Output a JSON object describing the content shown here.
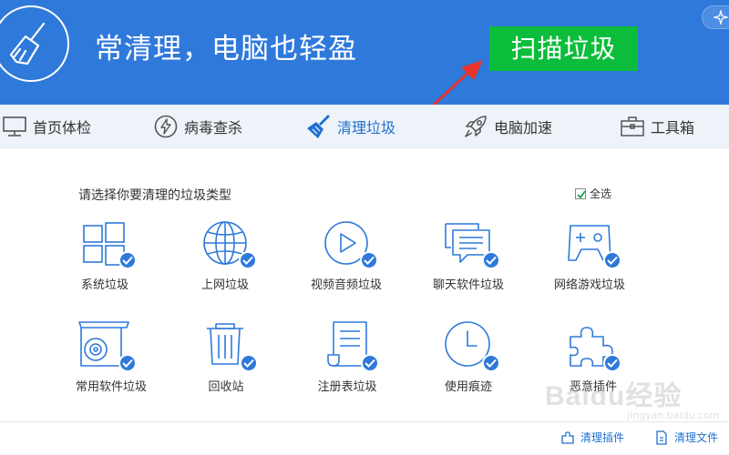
{
  "header": {
    "slogan": "常清理，电脑也轻盈",
    "scan_button": "扫描垃圾",
    "colors": {
      "header_bg": "#2f79db",
      "scan_bg": "#0bbd3a",
      "arrow": "#e8342a"
    }
  },
  "nav": {
    "items": [
      {
        "label": "首页体检",
        "icon": "monitor-icon"
      },
      {
        "label": "病毒查杀",
        "icon": "lightning-icon"
      },
      {
        "label": "清理垃圾",
        "icon": "broom-icon",
        "active": true
      },
      {
        "label": "电脑加速",
        "icon": "rocket-icon"
      },
      {
        "label": "工具箱",
        "icon": "toolbox-icon"
      }
    ]
  },
  "main": {
    "title": "请选择你要清理的垃圾类型",
    "select_all": "全选",
    "items": [
      {
        "label": "系统垃圾",
        "icon": "windows-icon",
        "checked": true
      },
      {
        "label": "上网垃圾",
        "icon": "globe-icon",
        "checked": true
      },
      {
        "label": "视频音频垃圾",
        "icon": "play-icon",
        "checked": true
      },
      {
        "label": "聊天软件垃圾",
        "icon": "chat-icon",
        "checked": true
      },
      {
        "label": "网络游戏垃圾",
        "icon": "gamepad-icon",
        "checked": true
      },
      {
        "label": "常用软件垃圾",
        "icon": "software-box-icon",
        "checked": true
      },
      {
        "label": "回收站",
        "icon": "trash-icon",
        "checked": true
      },
      {
        "label": "注册表垃圾",
        "icon": "registry-icon",
        "checked": true
      },
      {
        "label": "使用痕迹",
        "icon": "clock-icon",
        "checked": true
      },
      {
        "label": "恶意插件",
        "icon": "puzzle-icon",
        "checked": true
      }
    ]
  },
  "footer": {
    "links": [
      {
        "label": "清理插件",
        "icon": "plugin-icon"
      },
      {
        "label": "清理文件",
        "icon": "file-icon"
      }
    ]
  },
  "watermark": {
    "text": "Baidu经验",
    "sub": "jingyan.baidu.com"
  }
}
